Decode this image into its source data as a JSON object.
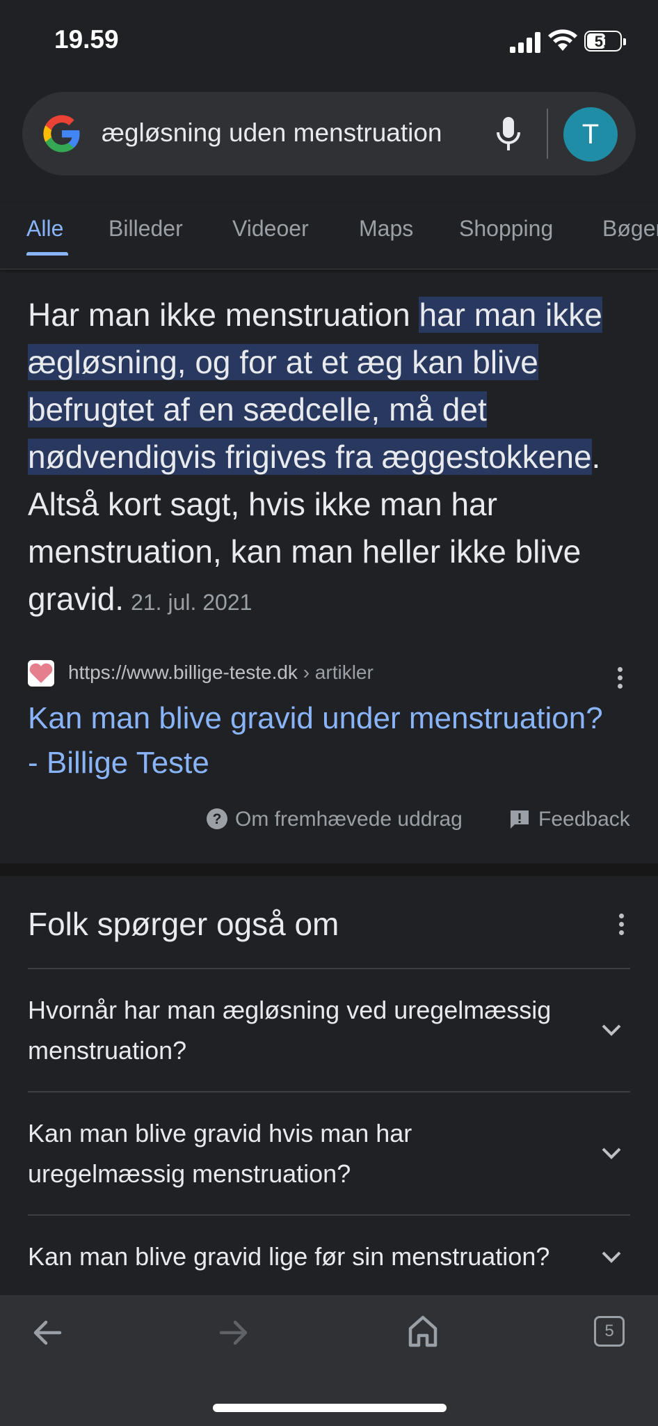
{
  "status_bar": {
    "time": "19.59",
    "battery": "51"
  },
  "search": {
    "query": "ægløsning uden menstruation",
    "avatar_letter": "T"
  },
  "tabs": [
    {
      "label": "Alle",
      "active": true
    },
    {
      "label": "Billeder"
    },
    {
      "label": "Videoer"
    },
    {
      "label": "Maps"
    },
    {
      "label": "Shopping"
    },
    {
      "label": "Bøger"
    }
  ],
  "featured_snippet": {
    "text_before": "Har man ikke menstruation ",
    "highlighted": "har man ikke ægløsning, og for at et æg kan blive befrugtet af en sædcelle, må det nødvendigvis frigives fra æggestokkene",
    "text_after": ". Altså kort sagt, hvis ikke man har menstruation, kan man heller ikke blive gravid.",
    "date": "21. jul. 2021",
    "source_url": "https://www.billige-teste.dk",
    "source_crumb": " › artikler",
    "title": "Kan man blive gravid under menstruation? - Billige Teste",
    "about_label": "Om fremhævede uddrag",
    "feedback_label": "Feedback"
  },
  "people_also_ask": {
    "title": "Folk spørger også om",
    "questions": [
      "Hvornår har man ægløsning ved uregelmæssig menstruation?",
      "Kan man blive gravid hvis man har uregelmæssig menstruation?",
      "Kan man blive gravid lige før sin menstruation?"
    ]
  },
  "toolbar": {
    "tab_count": "5"
  },
  "colors": {
    "background": "#202124",
    "link": "#8ab4f8",
    "highlight": "#28385e",
    "surface": "#303134"
  }
}
